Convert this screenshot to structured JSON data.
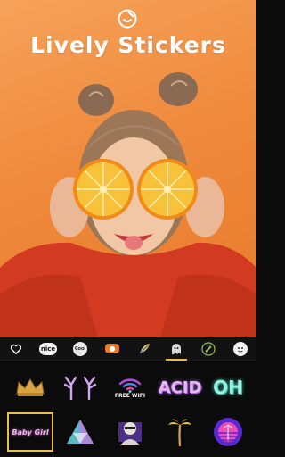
{
  "header": {
    "title": "Lively Stickers",
    "badge_icon": "sticker-smile-icon"
  },
  "tabs": [
    {
      "name": "heart",
      "icon": "heart-outline-icon",
      "label": ""
    },
    {
      "name": "nice",
      "icon": "nice-text-icon",
      "label": "nice"
    },
    {
      "name": "cool",
      "icon": "cool-text-icon",
      "label": "Cool"
    },
    {
      "name": "video",
      "icon": "video-badge-icon",
      "label": ""
    },
    {
      "name": "feather",
      "icon": "feather-icon",
      "label": ""
    },
    {
      "name": "ghost",
      "icon": "ghost-icon",
      "label": ""
    },
    {
      "name": "pencil",
      "icon": "pencil-icon",
      "label": ""
    },
    {
      "name": "face",
      "icon": "face-icon",
      "label": ""
    }
  ],
  "active_tab": 5,
  "stickers": {
    "row1": [
      {
        "name": "crown",
        "icon": "gold-crown-icon"
      },
      {
        "name": "antlers",
        "icon": "neon-antlers-icon"
      },
      {
        "name": "free-wifi",
        "icon": "wifi-icon",
        "label": "FREE WIFI"
      },
      {
        "name": "acid",
        "icon": "acid-text-icon",
        "label": "ACID"
      },
      {
        "name": "oh",
        "icon": "oh-text-icon",
        "label": "OH"
      }
    ],
    "row2": [
      {
        "name": "baby-girl",
        "icon": "baby-girl-text-icon",
        "label": "Baby Girl"
      },
      {
        "name": "prism",
        "icon": "prism-icon"
      },
      {
        "name": "statue",
        "icon": "statue-icon"
      },
      {
        "name": "palm",
        "icon": "palm-tree-icon"
      },
      {
        "name": "sunset",
        "icon": "retro-sunset-icon"
      }
    ],
    "selected": "baby-girl"
  },
  "colors": {
    "background": "#0b0b0b",
    "hero_orange": "#ef8a3c",
    "accent_gold": "#e8c04e",
    "title_white": "#ffffff"
  }
}
